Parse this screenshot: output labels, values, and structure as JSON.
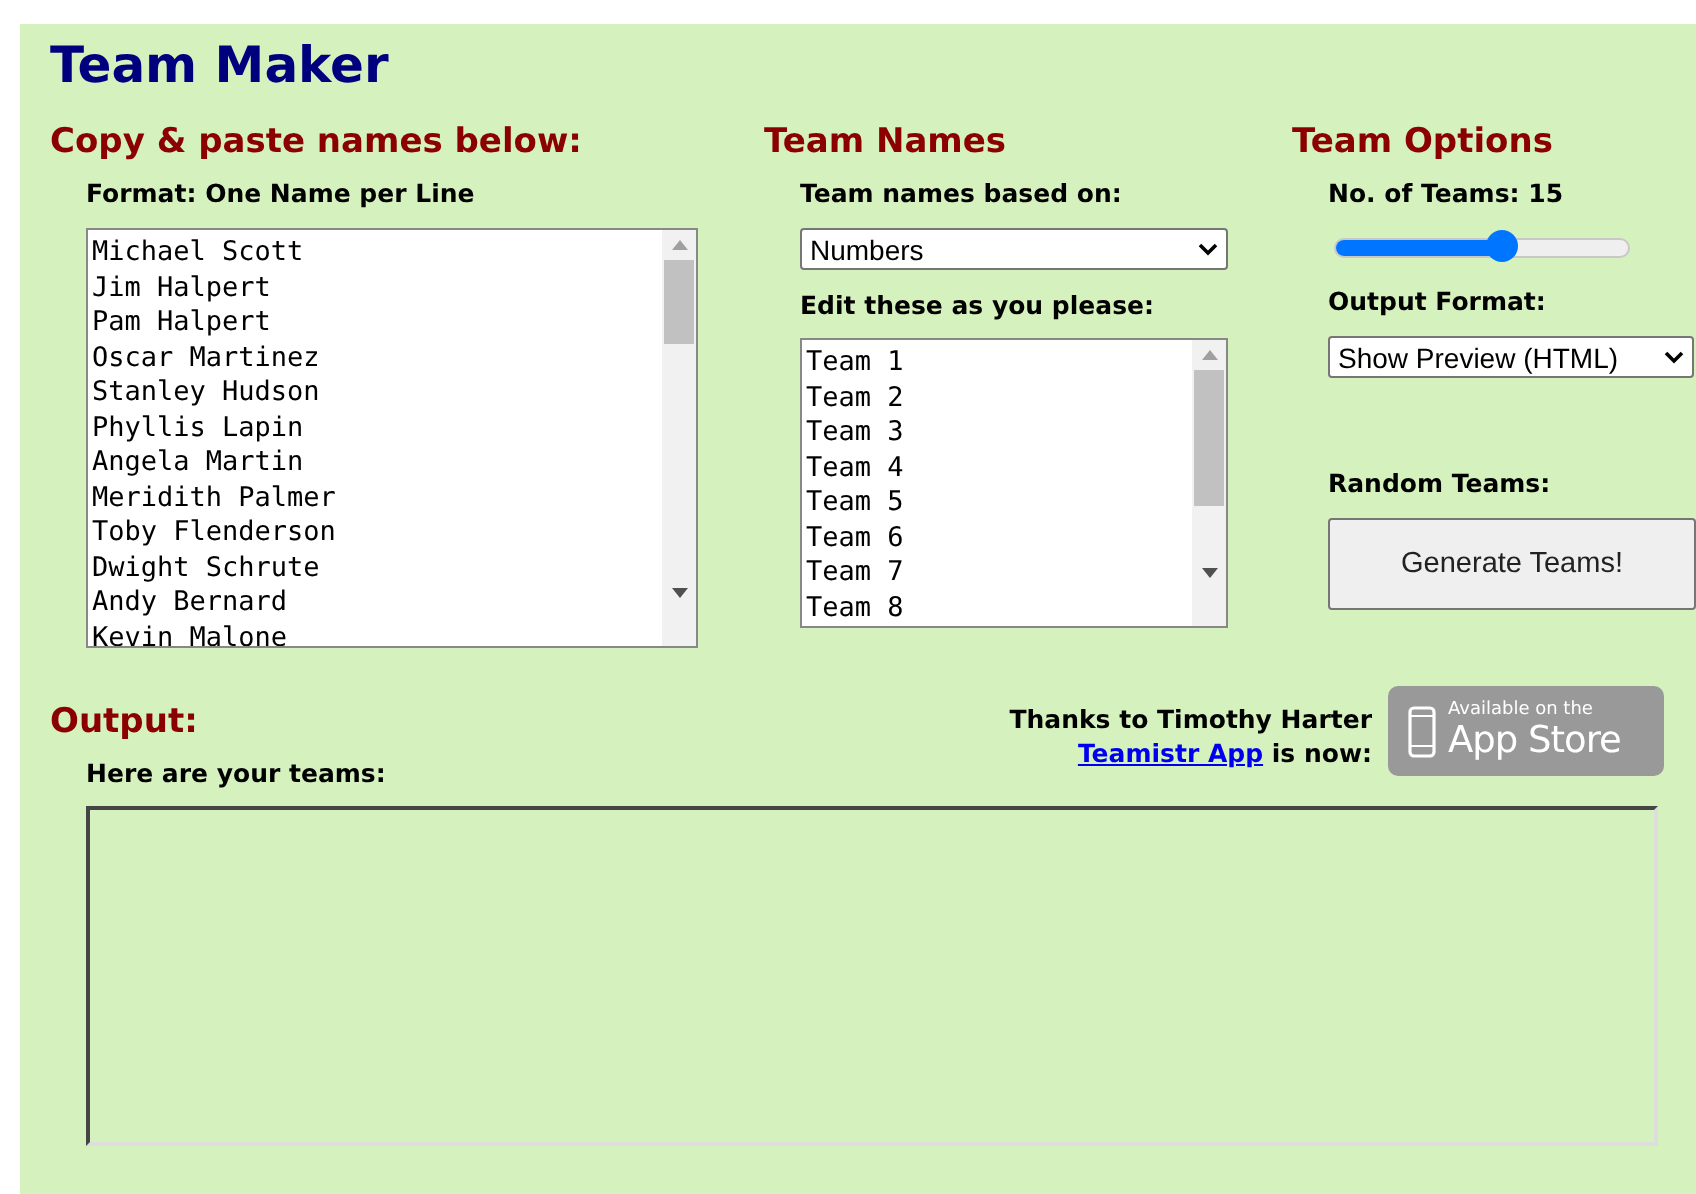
{
  "title": "Team Maker",
  "names_section": {
    "heading": "Copy & paste names below:",
    "format_label": "Format: One Name per Line",
    "names": [
      "Michael Scott",
      "Jim Halpert",
      "Pam Halpert",
      "Oscar Martinez",
      "Stanley Hudson",
      "Phyllis Lapin",
      "Angela Martin",
      "Meridith Palmer",
      "Toby Flenderson",
      "Dwight Schrute",
      "Andy Bernard",
      "Kevin Malone"
    ]
  },
  "team_names_section": {
    "heading": "Team Names",
    "based_on_label": "Team names based on:",
    "based_on_value": "Numbers",
    "edit_label": "Edit these as you please:",
    "team_names": [
      "Team 1",
      "Team 2",
      "Team 3",
      "Team 4",
      "Team 5",
      "Team 6",
      "Team 7",
      "Team 8"
    ]
  },
  "options_section": {
    "heading": "Team Options",
    "teams_label": "No. of Teams: 15",
    "teams_slider": {
      "level": 0.57
    },
    "output_format_label": "Output Format:",
    "output_format_value": "Show Preview (HTML)",
    "random_label": "Random Teams:",
    "generate_button": "Generate Teams!"
  },
  "output_section": {
    "heading": "Output:",
    "teams_label": "Here are your teams:",
    "thanks_text": "Thanks to Timothy Harter",
    "app_link": "Teamistr App",
    "app_suffix": " is now:",
    "badge_small": "Available on the",
    "badge_large": "App Store"
  }
}
